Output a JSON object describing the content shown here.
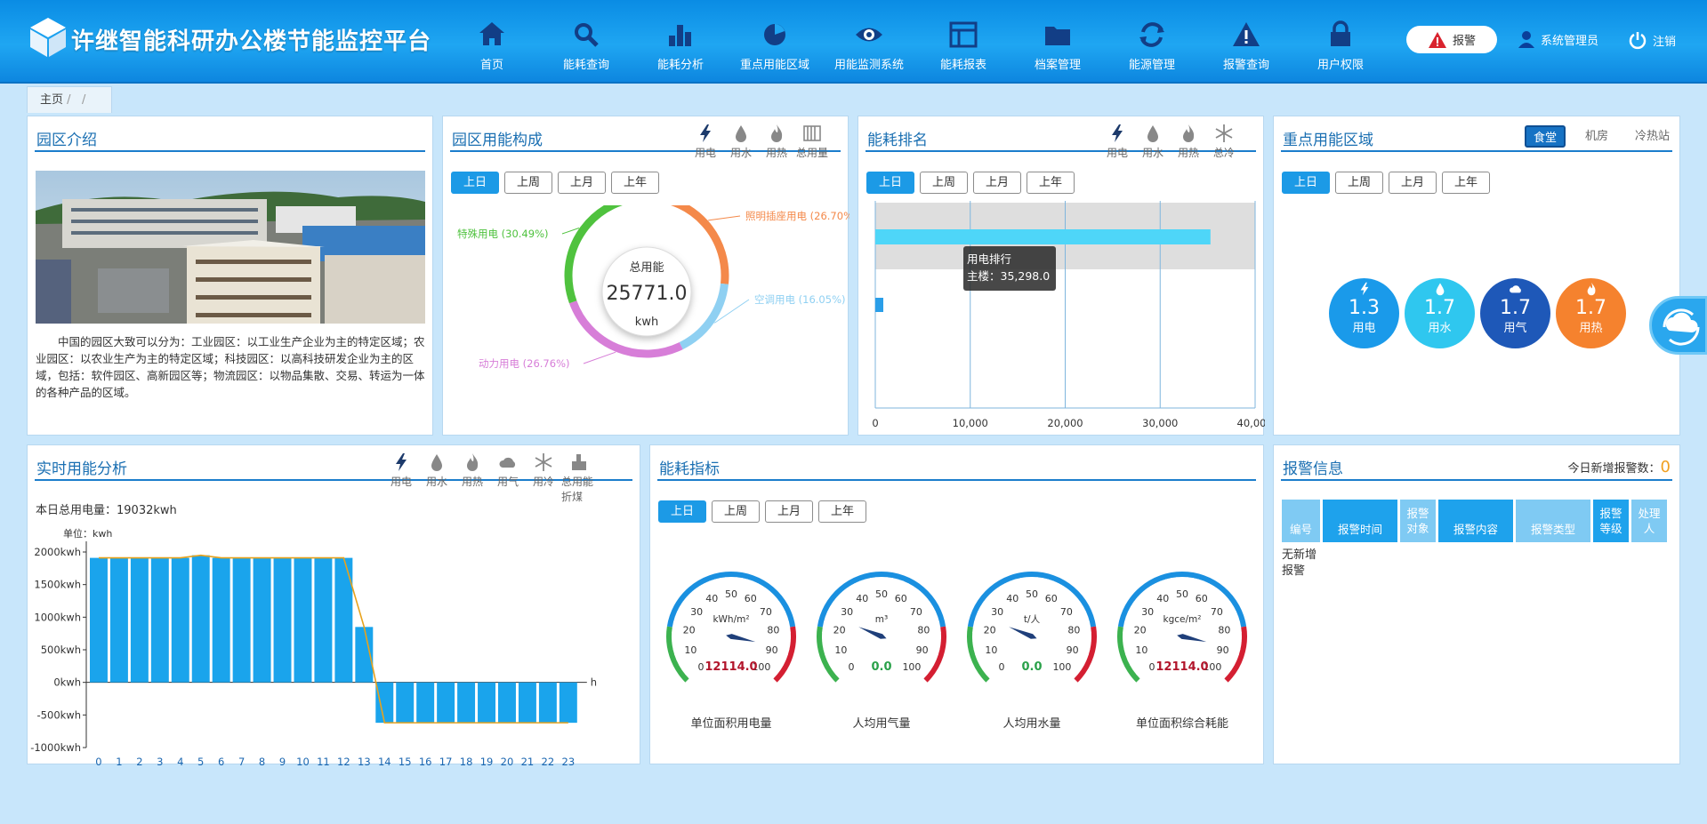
{
  "header": {
    "title": "许继智能科研办公楼节能监控平台",
    "alarm_label": "报警",
    "user": "系统管理员",
    "logout": "注销"
  },
  "nav": [
    "首页",
    "能耗查询",
    "能耗分析",
    "重点用能区域",
    "用能监测系统",
    "能耗报表",
    "档案管理",
    "能源管理",
    "报警查询",
    "用户权限"
  ],
  "breadcrumb": {
    "home": "主页",
    "sep1": "/",
    "sep2": "/"
  },
  "intro": {
    "title": "园区介绍",
    "text": "中国的园区大致可以分为：工业园区：以工业生产企业为主的特定区域；农业园区：以农业生产为主的特定区域；科技园区：以高科技研发企业为主的区域，包括：软件园区、高新园区等；物流园区：以物品集散、交易、转运为一体的各种产品的区域。"
  },
  "composition": {
    "title": "园区用能构成",
    "icons": [
      "用电",
      "用水",
      "用热",
      "总用量"
    ],
    "tabs": [
      "上日",
      "上周",
      "上月",
      "上年"
    ],
    "center_label": "总用能",
    "total": "25771.0",
    "unit": "kwh",
    "slices": [
      {
        "label": "照明插座用电 (26.70%)",
        "value": 26.7,
        "color": "#f4894a"
      },
      {
        "label": "空调用电 (16.05%)",
        "value": 16.05,
        "color": "#8fd0f2"
      },
      {
        "label": "动力用电 (26.76%)",
        "value": 26.76,
        "color": "#d77ed8"
      },
      {
        "label": "特殊用电 (30.49%)",
        "value": 30.49,
        "color": "#4fc23e"
      }
    ]
  },
  "ranking": {
    "title": "能耗排名",
    "icons": [
      "用电",
      "用水",
      "用热",
      "总冷"
    ],
    "tabs": [
      "上日",
      "上周",
      "上月",
      "上年"
    ],
    "ticks": [
      "0",
      "10,000",
      "20,000",
      "30,000",
      "40,00"
    ],
    "tooltip_title": "用电排行",
    "tooltip_value": "主楼：35,298.0"
  },
  "keyarea": {
    "title": "重点用能区域",
    "subtabs": [
      "食堂",
      "机房",
      "冷热站"
    ],
    "tabs": [
      "上日",
      "上周",
      "上月",
      "上年"
    ],
    "bubbles": [
      {
        "value": "1.3",
        "label": "用电",
        "color": "#1a9aea"
      },
      {
        "value": "1.7",
        "label": "用水",
        "color": "#2fc7ef"
      },
      {
        "value": "1.7",
        "label": "用气",
        "color": "#1e58b8"
      },
      {
        "value": "1.7",
        "label": "用热",
        "color": "#f5822e"
      }
    ]
  },
  "realtime": {
    "title": "实时用能分析",
    "icons": [
      "用电",
      "用水",
      "用热",
      "用气",
      "用冷",
      "总用能折煤"
    ],
    "summary": "本日总用电量：19032kwh",
    "unit": "单位：kwh",
    "xunit": "h"
  },
  "indicators": {
    "title": "能耗指标",
    "tabs": [
      "上日",
      "上周",
      "上月",
      "上年"
    ],
    "gauges": [
      {
        "unit": "kWh/m²",
        "value": "12114.0",
        "color": "#b2152b",
        "label": "单位面积用电量",
        "needle": 88
      },
      {
        "unit": "m³",
        "value": "0.0",
        "color": "#2aa14a",
        "label": "人均用气量",
        "needle": 25
      },
      {
        "unit": "t/人",
        "value": "0.0",
        "color": "#2aa14a",
        "label": "人均用水量",
        "needle": 25
      },
      {
        "unit": "kgce/m²",
        "value": "12114.0",
        "color": "#b2152b",
        "label": "单位面积综合耗能",
        "needle": 88
      }
    ]
  },
  "alarm": {
    "title": "报警信息",
    "count_label": "今日新增报警数：",
    "count": "0",
    "cols": [
      "编号",
      "报警时间",
      "报警\n对象",
      "报警内容",
      "报警类型",
      "报警\n等级",
      "处理\n人"
    ],
    "empty": "无新增\n报警"
  },
  "chart_data": {
    "type": "bar",
    "title": "",
    "xlabel": "h",
    "ylabel": "单位：kwh",
    "categories": [
      "0",
      "1",
      "2",
      "3",
      "4",
      "5",
      "6",
      "7",
      "8",
      "9",
      "10",
      "11",
      "12",
      "13",
      "14",
      "15",
      "16",
      "17",
      "18",
      "19",
      "20",
      "21",
      "22",
      "23"
    ],
    "values": [
      1910,
      1910,
      1910,
      1910,
      1910,
      1950,
      1910,
      1910,
      1910,
      1910,
      1910,
      1910,
      1910,
      850,
      -620,
      -620,
      -620,
      -620,
      -620,
      -620,
      -620,
      -620,
      -620,
      -620
    ],
    "ylim": [
      -1000,
      2000
    ],
    "yticks": [
      "2000kwh",
      "1500kwh",
      "1000kwh",
      "500kwh",
      "0kwh",
      "-500kwh",
      "-1000kwh"
    ]
  },
  "gauge_scale": [
    "0",
    "10",
    "20",
    "30",
    "40",
    "50",
    "60",
    "70",
    "80",
    "90",
    "100"
  ]
}
